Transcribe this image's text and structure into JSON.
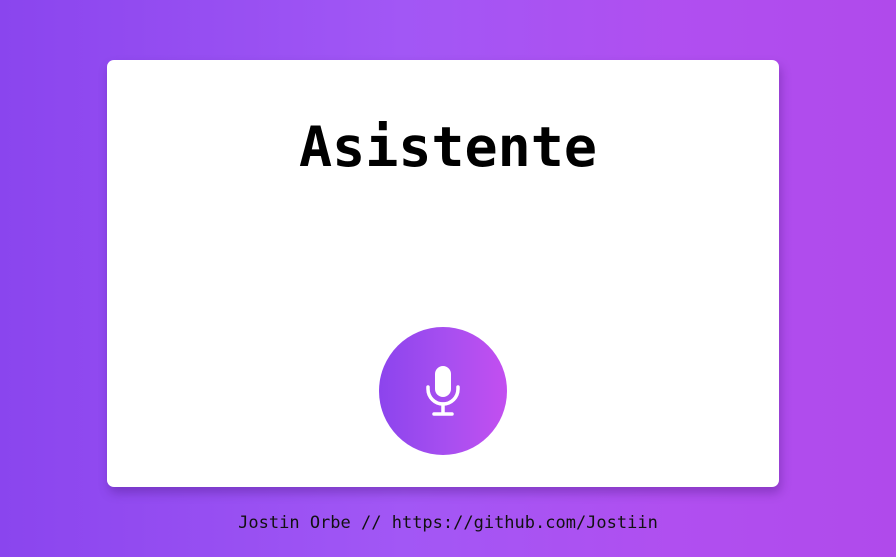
{
  "header": {
    "title": "Asistente"
  },
  "controls": {
    "mic_icon": "microphone-icon"
  },
  "footer": {
    "author": "Jostin Orbe",
    "separator": " // ",
    "link": "https://github.com/Jostiin"
  },
  "colors": {
    "background_start": "#8a45ee",
    "background_end": "#b04aeb",
    "card": "#ffffff",
    "button_start": "#8c44ed",
    "button_end": "#c34ff0",
    "icon": "#ffffff"
  }
}
